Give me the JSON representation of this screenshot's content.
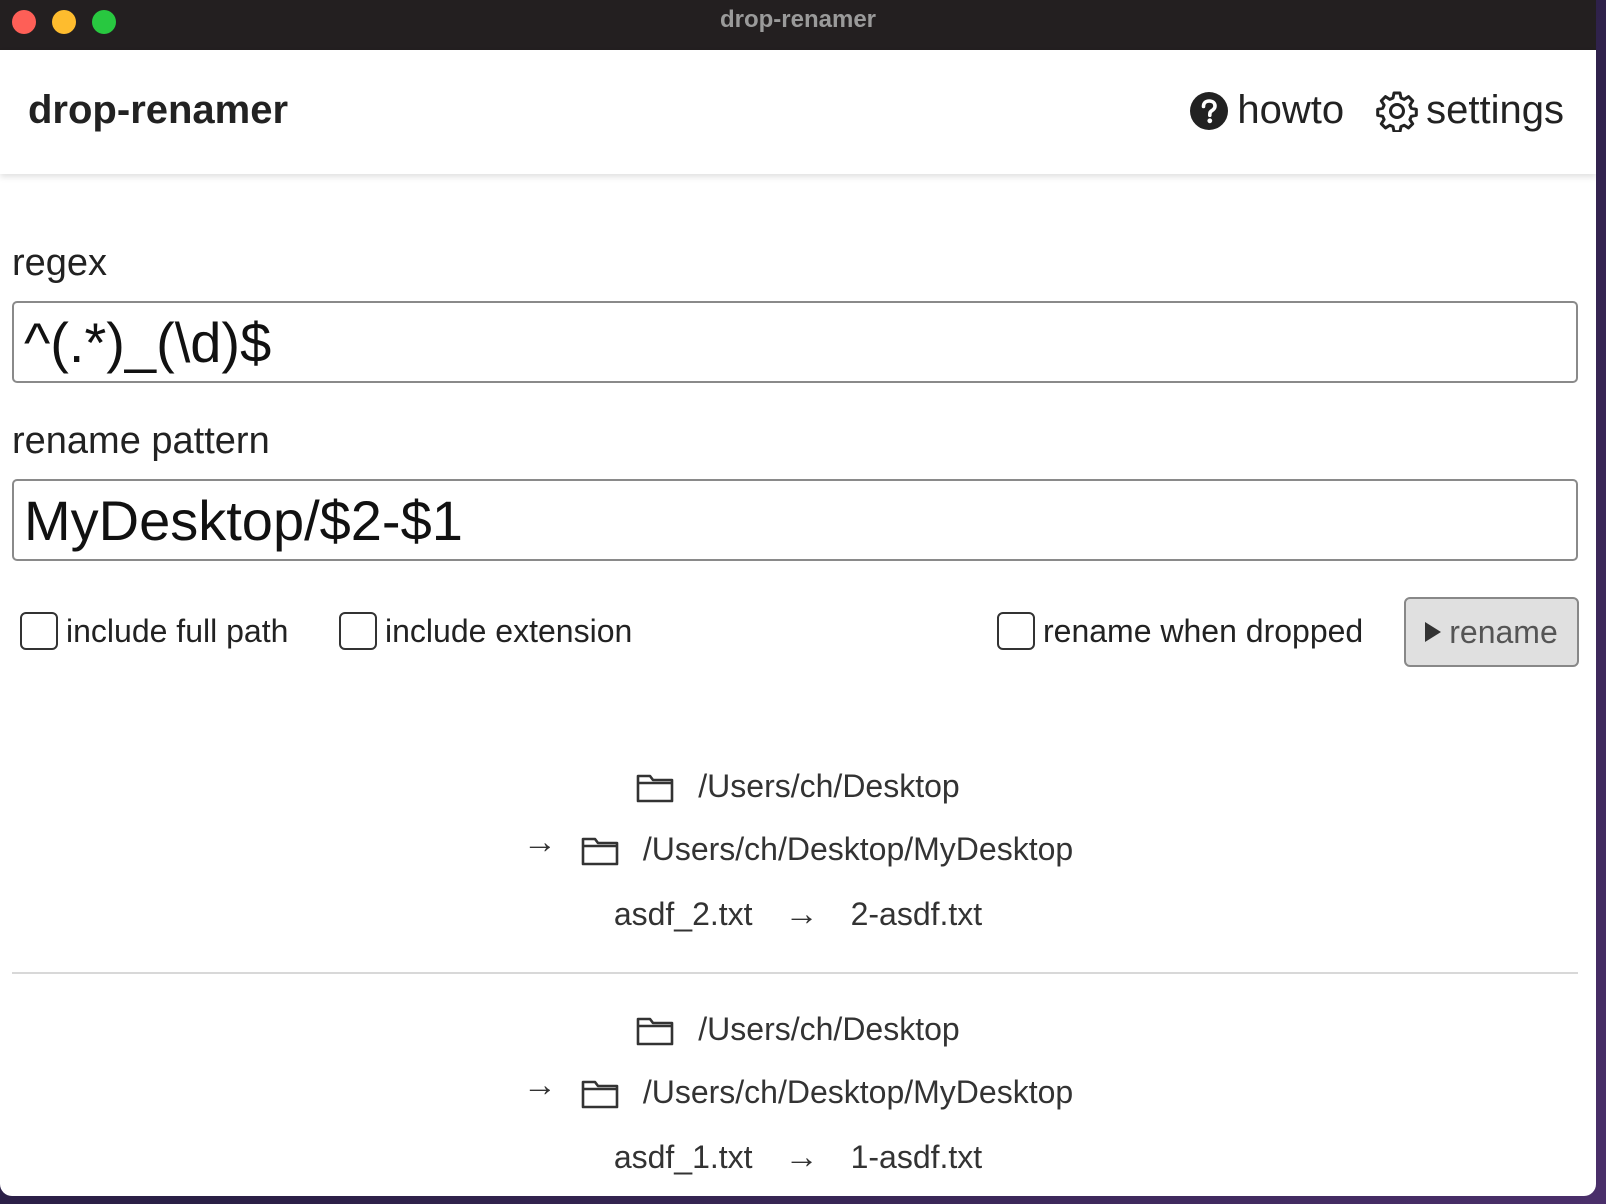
{
  "window": {
    "title": "drop-renamer"
  },
  "appbar": {
    "app_name": "drop-renamer",
    "howto_label": "howto",
    "settings_label": "settings"
  },
  "form": {
    "regex_label": "regex",
    "regex_value": "^(.*)_(\\d)$",
    "pattern_label": "rename pattern",
    "pattern_value": "MyDesktop/$2-$1"
  },
  "options": {
    "include_full_path": {
      "label": "include full path",
      "checked": false
    },
    "include_extension": {
      "label": "include extension",
      "checked": false
    },
    "rename_when_dropped": {
      "label": "rename when dropped",
      "checked": false
    },
    "rename_button_label": "rename"
  },
  "entries": [
    {
      "source_dir": "/Users/ch/Desktop",
      "target_dir": "/Users/ch/Desktop/MyDesktop",
      "old_name": "asdf_2.txt",
      "new_name": "2-asdf.txt"
    },
    {
      "source_dir": "/Users/ch/Desktop",
      "target_dir": "/Users/ch/Desktop/MyDesktop",
      "old_name": "asdf_1.txt",
      "new_name": "1-asdf.txt"
    }
  ]
}
